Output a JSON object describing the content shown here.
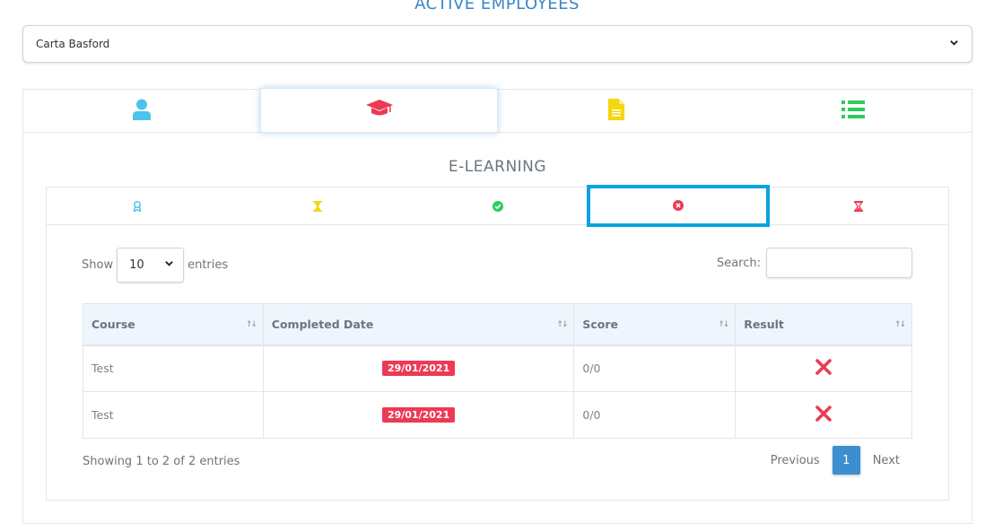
{
  "page": {
    "title": "ACTIVE EMPLOYEES"
  },
  "employee_select": {
    "value": "Carta Basford"
  },
  "main_tabs": [
    {
      "icon": "user-icon",
      "color": "#4cc3ea"
    },
    {
      "icon": "graduation-cap-icon",
      "color": "#ec3a55",
      "active": true
    },
    {
      "icon": "document-icon",
      "color": "#f6d60f"
    },
    {
      "icon": "list-icon",
      "color": "#2dcc5c"
    }
  ],
  "section": {
    "title": "E-LEARNING"
  },
  "sub_tabs": [
    {
      "icon": "award-icon",
      "color": "#4cc3ea"
    },
    {
      "icon": "hourglass-icon",
      "color": "#f6d60f"
    },
    {
      "icon": "check-circle-icon",
      "color": "#2dcc5c"
    },
    {
      "icon": "times-circle-icon",
      "color": "#ec3a55",
      "selected": true
    },
    {
      "icon": "hourglass-end-icon",
      "color": "#ec3a55"
    }
  ],
  "table_controls": {
    "show_label": "Show",
    "entries_value": "10",
    "entries_label": "entries",
    "search_label": "Search:"
  },
  "table": {
    "headers": [
      "Course",
      "Completed Date",
      "Score",
      "Result"
    ],
    "rows": [
      {
        "course": "Test",
        "completed_date": "29/01/2021",
        "score": "0/0",
        "result": "fail"
      },
      {
        "course": "Test",
        "completed_date": "29/01/2021",
        "score": "0/0",
        "result": "fail"
      }
    ]
  },
  "footer": {
    "info": "Showing 1 to 2 of 2 entries",
    "previous": "Previous",
    "page": "1",
    "next": "Next"
  },
  "colors": {
    "accent": "#3b86c4",
    "danger": "#ec3a55",
    "highlight": "#0aa3e3"
  }
}
